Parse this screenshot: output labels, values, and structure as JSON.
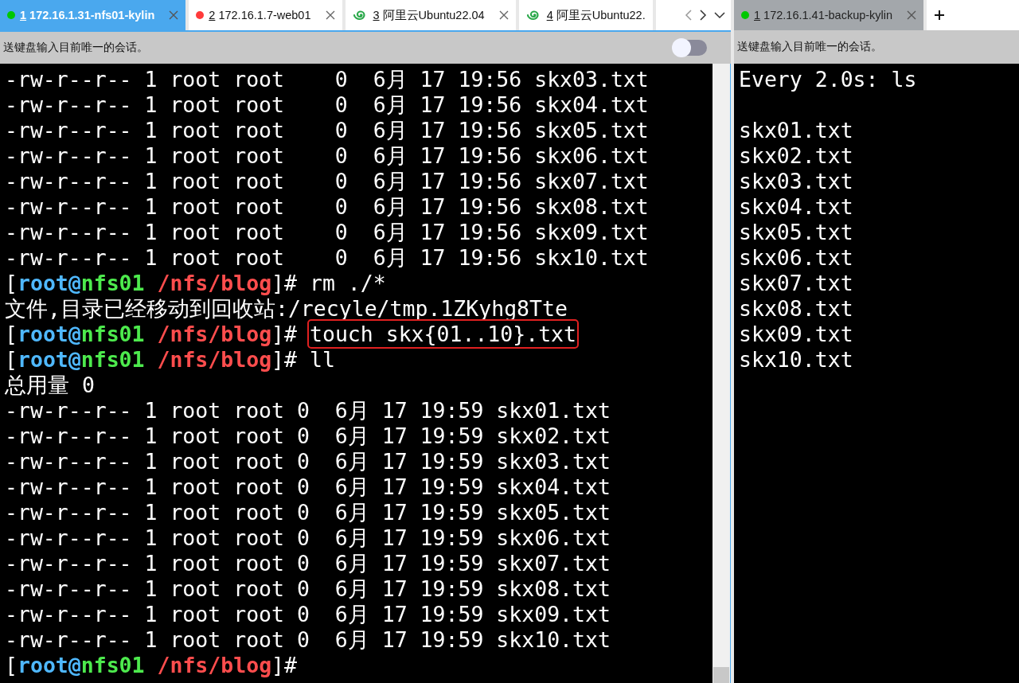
{
  "panes": [
    {
      "active": true,
      "tabs": [
        {
          "number": "1",
          "label": "172.16.1.31-nfs01-kylin",
          "kind": "dot",
          "color": "#00c800",
          "selected": true,
          "closable": true
        },
        {
          "number": "2",
          "label": "172.16.1.7-web01",
          "kind": "dot",
          "color": "#ff3b3b",
          "selected": false,
          "closable": true
        },
        {
          "number": "3",
          "label": "阿里云Ubuntu22.04",
          "kind": "spiral",
          "selected": false,
          "closable": true
        },
        {
          "number": "4",
          "label": "阿里云Ubuntu22.",
          "kind": "spiral",
          "selected": false,
          "closable": false
        }
      ],
      "nav": true,
      "info": "送键盘输入目前唯一的会话。",
      "toggle": {
        "on": false
      },
      "scrollbar": true,
      "lines": [
        {
          "kind": "text",
          "text": "-rw-r--r-- 1 root root    0  6月 17 19:56 skx03.txt"
        },
        {
          "kind": "text",
          "text": "-rw-r--r-- 1 root root    0  6月 17 19:56 skx04.txt"
        },
        {
          "kind": "text",
          "text": "-rw-r--r-- 1 root root    0  6月 17 19:56 skx05.txt"
        },
        {
          "kind": "text",
          "text": "-rw-r--r-- 1 root root    0  6月 17 19:56 skx06.txt"
        },
        {
          "kind": "text",
          "text": "-rw-r--r-- 1 root root    0  6月 17 19:56 skx07.txt"
        },
        {
          "kind": "text",
          "text": "-rw-r--r-- 1 root root    0  6月 17 19:56 skx08.txt"
        },
        {
          "kind": "text",
          "text": "-rw-r--r-- 1 root root    0  6月 17 19:56 skx09.txt"
        },
        {
          "kind": "text",
          "text": "-rw-r--r-- 1 root root    0  6月 17 19:56 skx10.txt"
        },
        {
          "kind": "prompt",
          "open": "[",
          "user": "root@",
          "host": "nfs01",
          "path": "/nfs/blog",
          "close": "]#",
          "command": "rm ./*",
          "highlighted": false
        },
        {
          "kind": "text",
          "text": "文件,目录已经移动到回收站:/recyle/tmp.1ZKyhg8Tte"
        },
        {
          "kind": "prompt",
          "open": "[",
          "user": "root@",
          "host": "nfs01",
          "path": "/nfs/blog",
          "close": "]#",
          "command": "touch skx{01..10}.txt",
          "highlighted": true
        },
        {
          "kind": "prompt",
          "open": "[",
          "user": "root@",
          "host": "nfs01",
          "path": "/nfs/blog",
          "close": "]#",
          "command": "ll",
          "highlighted": false
        },
        {
          "kind": "text",
          "text": "总用量 0"
        },
        {
          "kind": "text",
          "text": "-rw-r--r-- 1 root root 0  6月 17 19:59 skx01.txt"
        },
        {
          "kind": "text",
          "text": "-rw-r--r-- 1 root root 0  6月 17 19:59 skx02.txt"
        },
        {
          "kind": "text",
          "text": "-rw-r--r-- 1 root root 0  6月 17 19:59 skx03.txt"
        },
        {
          "kind": "text",
          "text": "-rw-r--r-- 1 root root 0  6月 17 19:59 skx04.txt"
        },
        {
          "kind": "text",
          "text": "-rw-r--r-- 1 root root 0  6月 17 19:59 skx05.txt"
        },
        {
          "kind": "text",
          "text": "-rw-r--r-- 1 root root 0  6月 17 19:59 skx06.txt"
        },
        {
          "kind": "text",
          "text": "-rw-r--r-- 1 root root 0  6月 17 19:59 skx07.txt"
        },
        {
          "kind": "text",
          "text": "-rw-r--r-- 1 root root 0  6月 17 19:59 skx08.txt"
        },
        {
          "kind": "text",
          "text": "-rw-r--r-- 1 root root 0  6月 17 19:59 skx09.txt"
        },
        {
          "kind": "text",
          "text": "-rw-r--r-- 1 root root 0  6月 17 19:59 skx10.txt"
        },
        {
          "kind": "prompt",
          "open": "[",
          "user": "root@",
          "host": "nfs01",
          "path": "/nfs/blog",
          "close": "]#"
        }
      ]
    },
    {
      "active": false,
      "tabs": [
        {
          "number": "1",
          "label": "172.16.1.41-backup-kylin",
          "kind": "dot",
          "color": "#00c800",
          "selected": true,
          "closable": true
        }
      ],
      "add": true,
      "info": "送键盘输入目前唯一的会话。",
      "lines": [
        {
          "kind": "text",
          "text": "Every 2.0s: ls"
        },
        {
          "kind": "blank"
        },
        {
          "kind": "text",
          "text": "skx01.txt"
        },
        {
          "kind": "text",
          "text": "skx02.txt"
        },
        {
          "kind": "text",
          "text": "skx03.txt"
        },
        {
          "kind": "text",
          "text": "skx04.txt"
        },
        {
          "kind": "text",
          "text": "skx05.txt"
        },
        {
          "kind": "text",
          "text": "skx06.txt"
        },
        {
          "kind": "text",
          "text": "skx07.txt"
        },
        {
          "kind": "text",
          "text": "skx08.txt"
        },
        {
          "kind": "text",
          "text": "skx09.txt"
        },
        {
          "kind": "text",
          "text": "skx10.txt"
        }
      ]
    }
  ]
}
